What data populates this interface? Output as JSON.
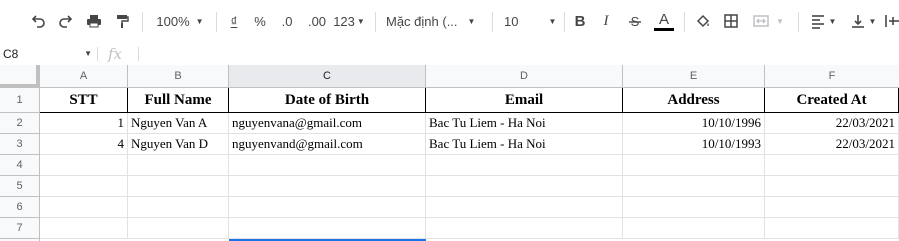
{
  "toolbar": {
    "zoom": "100%",
    "currency": "₫",
    "percent": "%",
    "decrease_decimal": ".0",
    "increase_decimal": ".00",
    "more_formats": "123",
    "font": "Mặc định (...",
    "font_size": "10",
    "bold": "B",
    "italic": "I",
    "text_color": "A",
    "text_color_value": "#000000"
  },
  "formula_bar": {
    "cell_ref": "C8",
    "fx": "fx",
    "content": ""
  },
  "columns": [
    "A",
    "B",
    "C",
    "D",
    "E",
    "F"
  ],
  "rows": [
    "1",
    "2",
    "3",
    "4",
    "5",
    "6",
    "7"
  ],
  "header": [
    "STT",
    "Full Name",
    "Date of Birth",
    "Email",
    "Address",
    "Created At"
  ],
  "data": [
    [
      "1",
      "Nguyen Van A",
      "nguyenvana@gmail.com",
      "Bac Tu Liem - Ha Noi",
      "10/10/1996",
      "22/03/2021"
    ],
    [
      "4",
      "Nguyen Van D",
      "nguyenvand@gmail.com",
      "Bac Tu Liem - Ha Noi",
      "10/10/1993",
      "22/03/2021"
    ]
  ],
  "colors": {
    "selection": "#1a73e8",
    "header_bg": "#f8f9fa",
    "selected_col_bg": "#e8eaed"
  }
}
